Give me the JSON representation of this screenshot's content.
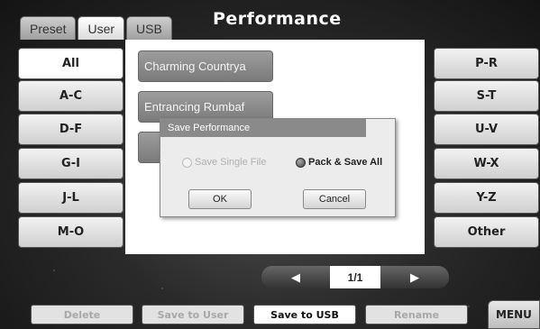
{
  "tabs": [
    {
      "label": "Preset"
    },
    {
      "label": "User",
      "active": true
    },
    {
      "label": "USB"
    }
  ],
  "title": "Performance",
  "categories_left": [
    "All",
    "A-C",
    "D-F",
    "G-I",
    "J-L",
    "M-O"
  ],
  "categories_right": [
    "P-R",
    "S-T",
    "U-V",
    "W-X",
    "Y-Z",
    "Other"
  ],
  "selected_category": "All",
  "presets": [
    "Charming Countrya",
    "Entrancing Rumbaf"
  ],
  "dialog": {
    "title": "Save Performance",
    "option_single": "Save Single File",
    "option_pack": "Pack & Save All",
    "selected_option": "Pack & Save All",
    "ok_label": "OK",
    "cancel_label": "Cancel"
  },
  "pager": {
    "prev_icon": "left-arrow-icon",
    "next_icon": "right-arrow-icon",
    "page": "1/1"
  },
  "bottom_bar": {
    "delete": "Delete",
    "save_to_user": "Save to User",
    "save_to_usb": "Save to USB",
    "rename": "Rename",
    "menu": "MENU"
  },
  "colors": {
    "panel": "#ffffff",
    "dialog_title_bar": "#8a8a8a",
    "disabled_text": "#a8a8a8"
  }
}
